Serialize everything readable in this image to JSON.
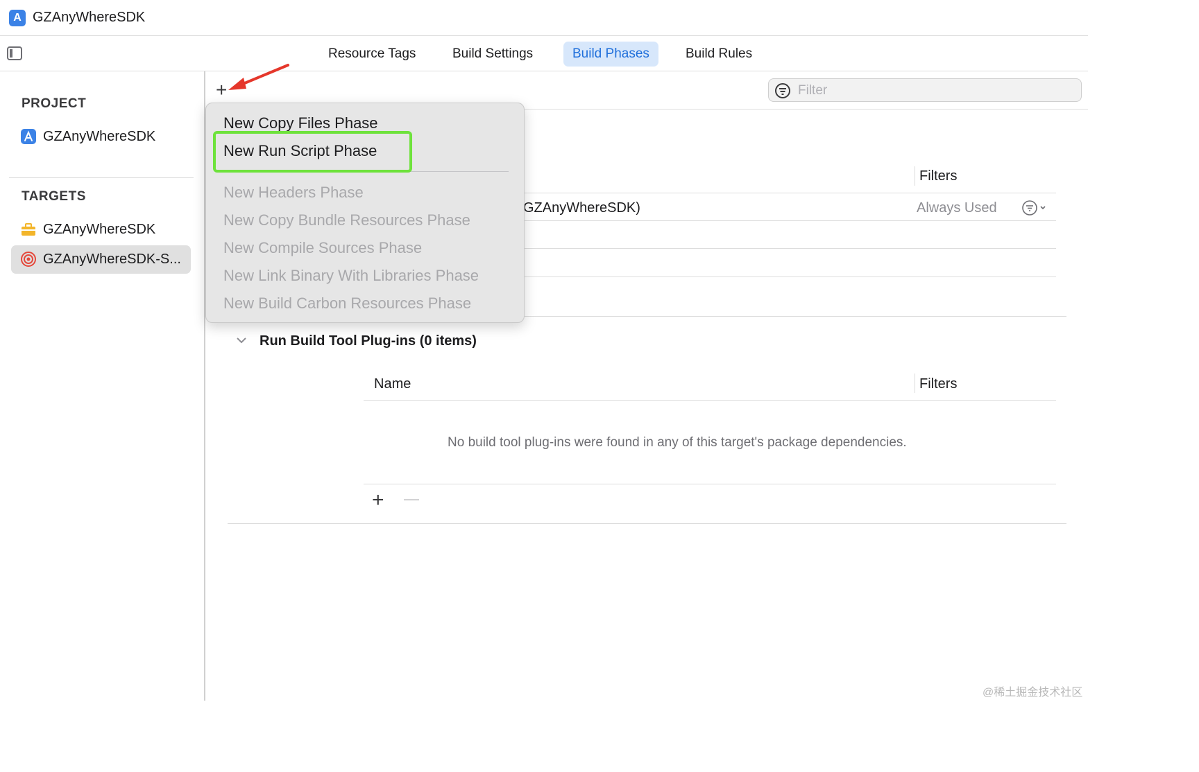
{
  "window": {
    "title": "GZAnyWhereSDK"
  },
  "tabs": [
    {
      "label": "Resource Tags",
      "active": false
    },
    {
      "label": "Build Settings",
      "active": false
    },
    {
      "label": "Build Phases",
      "active": true
    },
    {
      "label": "Build Rules",
      "active": false
    }
  ],
  "sidebar": {
    "project_header": "PROJECT",
    "project_item": "GZAnyWhereSDK",
    "targets_header": "TARGETS",
    "targets": [
      {
        "label": "GZAnyWhereSDK",
        "selected": false
      },
      {
        "label": "GZAnyWhereSDK-S...",
        "selected": true
      }
    ]
  },
  "toolbar": {
    "add_label": "+",
    "filter_placeholder": "Filter"
  },
  "menu": {
    "items": [
      {
        "label": "New Copy Files Phase",
        "enabled": true
      },
      {
        "label": "New Run Script Phase",
        "enabled": true,
        "highlighted": true
      },
      {
        "label": "New Headers Phase",
        "enabled": false
      },
      {
        "label": "New Copy Bundle Resources Phase",
        "enabled": false
      },
      {
        "label": "New Compile Sources Phase",
        "enabled": false
      },
      {
        "label": "New Link Binary With Libraries Phase",
        "enabled": false
      },
      {
        "label": "New Build Carbon Resources Phase",
        "enabled": false
      }
    ]
  },
  "dependencies_table": {
    "filters_header": "Filters",
    "row": {
      "name_fragment": "GZAnyWhereSDK)",
      "filter_value": "Always Used"
    }
  },
  "plugins_section": {
    "title": "Run Build Tool Plug-ins (0 items)",
    "name_header": "Name",
    "filters_header": "Filters",
    "empty_message": "No build tool plug-ins were found in any of this target's package dependencies.",
    "add_label": "+",
    "remove_label": "—"
  },
  "watermark": "@稀土掘金技术社区",
  "colors": {
    "accent": "#1f6fdb",
    "tab_active_bg": "#d7e7fb",
    "highlight": "#6ee23c",
    "arrow": "#e5372b"
  }
}
